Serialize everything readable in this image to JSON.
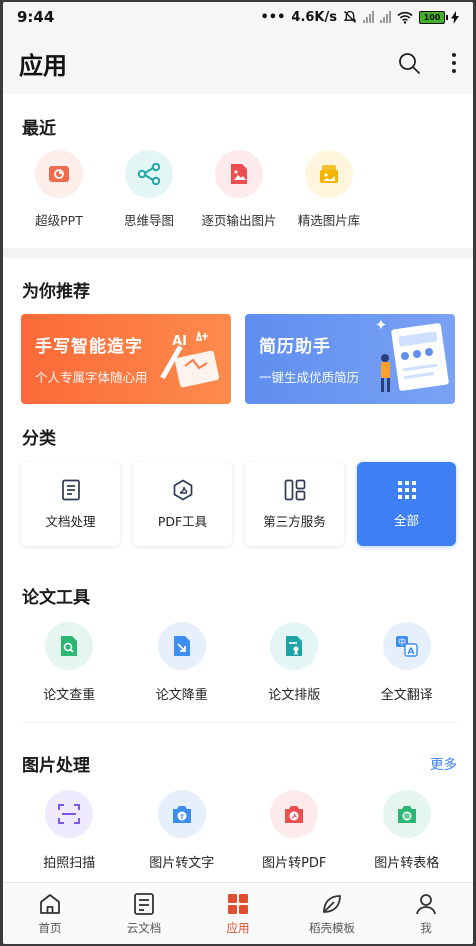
{
  "status": {
    "time": "9:44",
    "speed": "4.6K/s",
    "battery": "100"
  },
  "header": {
    "title": "应用"
  },
  "recent": {
    "title": "最近",
    "items": [
      {
        "label": "超级PPT",
        "icon": "ppt-icon"
      },
      {
        "label": "思维导图",
        "icon": "mindmap-icon"
      },
      {
        "label": "逐页输出图片",
        "icon": "image-export-icon"
      },
      {
        "label": "精选图片库",
        "icon": "image-library-icon"
      }
    ]
  },
  "recommend": {
    "title": "为你推荐",
    "banners": [
      {
        "title": "手写智能造字",
        "subtitle": "个人专属字体随心用",
        "badge": "AI"
      },
      {
        "title": "简历助手",
        "subtitle": "一键生成优质简历"
      }
    ]
  },
  "categories": {
    "title": "分类",
    "items": [
      {
        "label": "文档处理",
        "icon": "document-icon"
      },
      {
        "label": "PDF工具",
        "icon": "pdf-icon"
      },
      {
        "label": "第三方服务",
        "icon": "grid-layout-icon"
      },
      {
        "label": "全部",
        "icon": "all-apps-icon"
      }
    ]
  },
  "thesis": {
    "title": "论文工具",
    "items": [
      {
        "label": "论文查重",
        "icon": "thesis-check-icon"
      },
      {
        "label": "论文降重",
        "icon": "thesis-reduce-icon"
      },
      {
        "label": "论文排版",
        "icon": "thesis-format-icon"
      },
      {
        "label": "全文翻译",
        "icon": "translate-icon"
      }
    ]
  },
  "image_tools": {
    "title": "图片处理",
    "more": "更多",
    "items": [
      {
        "label": "拍照扫描",
        "icon": "scan-icon"
      },
      {
        "label": "图片转文字",
        "icon": "image-to-text-icon"
      },
      {
        "label": "图片转PDF",
        "icon": "image-to-pdf-icon"
      },
      {
        "label": "图片转表格",
        "icon": "image-to-table-icon"
      }
    ]
  },
  "nav": {
    "items": [
      {
        "label": "首页"
      },
      {
        "label": "云文档"
      },
      {
        "label": "应用"
      },
      {
        "label": "稻壳模板"
      },
      {
        "label": "我"
      }
    ]
  },
  "colors": {
    "accent": "#3f7ff5",
    "nav_active": "#e14e2d",
    "banner_orange": "#fb6a3a",
    "banner_blue": "#5f8ef0"
  }
}
